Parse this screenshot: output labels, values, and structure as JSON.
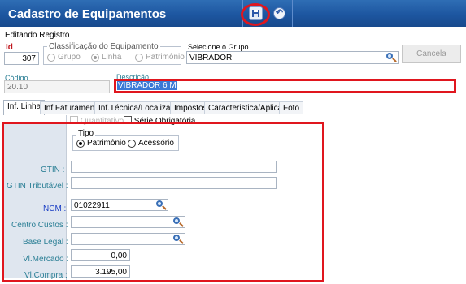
{
  "window": {
    "title": "Cadastro de Equipamentos"
  },
  "toolbar": {
    "save_icon": "save-disk-icon",
    "undo_icon": "undo-circle-icon",
    "undo_glyph": "↶"
  },
  "status": "Editando Registro",
  "id_field": {
    "label": "Id",
    "value": "307"
  },
  "classificacao": {
    "label": "Classificação do Equipamento",
    "options": [
      {
        "label": "Grupo",
        "selected": false
      },
      {
        "label": "Linha",
        "selected": true
      },
      {
        "label": "Patrimônio",
        "selected": false
      }
    ]
  },
  "grupo": {
    "label": "Selecione o Grupo",
    "value": "VIBRADOR"
  },
  "cancel_button": "Cancela",
  "codigo": {
    "label": "Código",
    "value": "20.10"
  },
  "descricao": {
    "label": "Descrição",
    "value": "VIBRADOR 6 M"
  },
  "tabs": [
    {
      "label": "Inf. Linha",
      "active": true
    },
    {
      "label": "Inf.Faturamento",
      "active": false
    },
    {
      "label": "Inf.Técnica/Localização",
      "active": false
    },
    {
      "label": "Impostos",
      "active": false
    },
    {
      "label": "Caracteristica/Aplicacao",
      "active": false
    },
    {
      "label": "Foto",
      "active": false
    }
  ],
  "checks": {
    "quantitativo": "Quantitativo",
    "serie_obrigatoria": "Série Obrigatória"
  },
  "tipo": {
    "label": "Tipo",
    "options": [
      {
        "label": "Patrimônio",
        "selected": true
      },
      {
        "label": "Acessório",
        "selected": false
      }
    ]
  },
  "form": {
    "gtin": {
      "label": "GTIN :",
      "value": ""
    },
    "gtin_tributavel": {
      "label": "GTIN Tributável :",
      "value": ""
    },
    "ncm": {
      "label": "NCM :",
      "value": "01022911"
    },
    "centro_custos": {
      "label": "Centro Custos :",
      "value": ""
    },
    "base_legal": {
      "label": "Base Legal :",
      "value": ""
    },
    "vl_mercado": {
      "label": "Vl.Mercado :",
      "value": "0,00"
    },
    "vl_compra": {
      "label": "Vl.Compra :",
      "value": "3.195,00"
    }
  },
  "colors": {
    "title_bar": "#1d56a0",
    "highlight": "#e0161e",
    "label_teal": "#2b7f95",
    "id_label": "#c0161e"
  }
}
